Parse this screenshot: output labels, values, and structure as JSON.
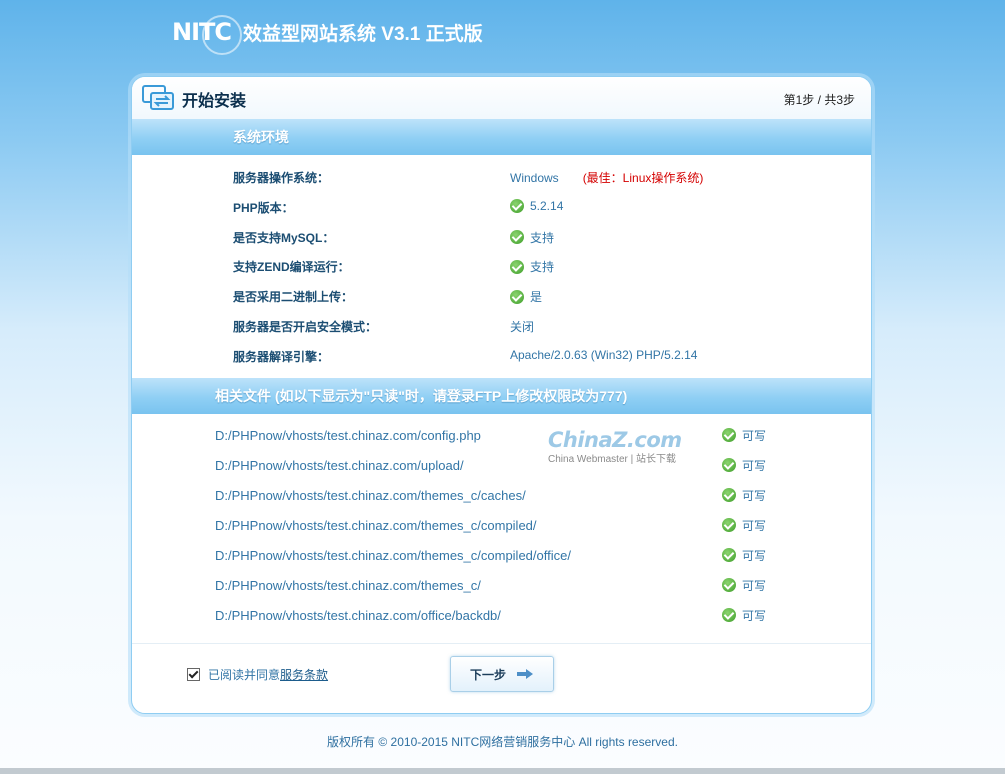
{
  "header": {
    "logo_text": "NITC",
    "product_title": "效益型网站系统 V3.1 正式版"
  },
  "card": {
    "title": "开始安装",
    "step_current": "第1步",
    "step_total": "/ 共3步"
  },
  "env_section": {
    "title": "系统环境",
    "rows": [
      {
        "label": "服务器操作系统：",
        "value": "Windows",
        "note": "(最佳：Linux操作系统)",
        "icon": "none"
      },
      {
        "label": "PHP版本：",
        "value": "5.2.14",
        "icon": "check-icon"
      },
      {
        "label": "是否支持MySQL：",
        "value": "支持",
        "icon": "check-icon"
      },
      {
        "label": "支持ZEND编译运行：",
        "value": "支持",
        "icon": "check-icon"
      },
      {
        "label": "是否采用二进制上传：",
        "value": "是",
        "icon": "check-icon"
      },
      {
        "label": "服务器是否开启安全模式：",
        "value": "关闭",
        "icon": "none"
      },
      {
        "label": "服务器解译引擎：",
        "value": "Apache/2.0.63 (Win32) PHP/5.2.14",
        "icon": "none"
      }
    ]
  },
  "files_section": {
    "title": "相关文件 (如以下显示为\"只读\"时，请登录FTP上修改权限改为777)",
    "rows": [
      {
        "path": "D:/PHPnow/vhosts/test.chinaz.com/config.php",
        "status": "可写"
      },
      {
        "path": "D:/PHPnow/vhosts/test.chinaz.com/upload/",
        "status": "可写"
      },
      {
        "path": "D:/PHPnow/vhosts/test.chinaz.com/themes_c/caches/",
        "status": "可写"
      },
      {
        "path": "D:/PHPnow/vhosts/test.chinaz.com/themes_c/compiled/",
        "status": "可写"
      },
      {
        "path": "D:/PHPnow/vhosts/test.chinaz.com/themes_c/compiled/office/",
        "status": "可写"
      },
      {
        "path": "D:/PHPnow/vhosts/test.chinaz.com/themes_c/",
        "status": "可写"
      },
      {
        "path": "D:/PHPnow/vhosts/test.chinaz.com/office/backdb/",
        "status": "可写"
      }
    ]
  },
  "watermark": {
    "main": "ChinaZ.com",
    "sub": "China Webmaster | 站长下载"
  },
  "footer": {
    "agree_prefix": "已阅读并同意",
    "agree_link": "服务条款",
    "next_button": "下一步",
    "copyright": "版权所有  ©  2010-2015 NITC网络营销服务中心  All rights reserved."
  },
  "colors": {
    "accent": "#3275a6",
    "warning": "#d40000",
    "ok": "#3f9f2a",
    "bar": "#8fcff4"
  }
}
